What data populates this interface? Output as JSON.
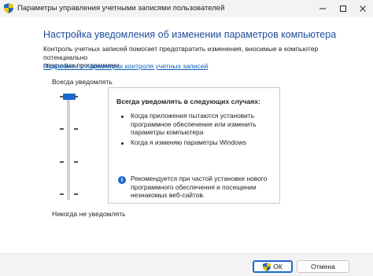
{
  "window": {
    "title": "Параметры управления учетными записями пользователей"
  },
  "heading": "Настройка уведомления об изменении параметров компьютера",
  "description_lines": [
    "Контроль учетных записей помогает предотвратить изменения, вносимые в компьютер потенциально",
    "опасными программами."
  ],
  "more_link": "Подробнее о параметрах контроля учетных записей",
  "slider": {
    "top_label": "Всегда уведомлять",
    "bottom_label": "Никогда не уведомлять",
    "positions": 4,
    "selected_level": 1
  },
  "info": {
    "title": "Всегда уведомлять в следующих случаях:",
    "items": [
      [
        "Когда приложения пытаются установить",
        "программное обеспечение или изменить",
        "параметры компьютера"
      ],
      [
        "Когда я изменяю параметры Windows"
      ]
    ],
    "note_lines": [
      "Рекомендуется при частой установке нового",
      "программного обеспечения и посещении",
      "незнакомых веб-сайтов."
    ]
  },
  "buttons": {
    "ok": "ОК",
    "cancel": "Отмена"
  },
  "colors": {
    "heading": "#1f4b9c",
    "accent": "#1c67c9",
    "link": "#0b5fc0"
  },
  "icons": {
    "app": "uac-shield-icon",
    "ok": "uac-shield-icon",
    "info": "info-icon"
  }
}
